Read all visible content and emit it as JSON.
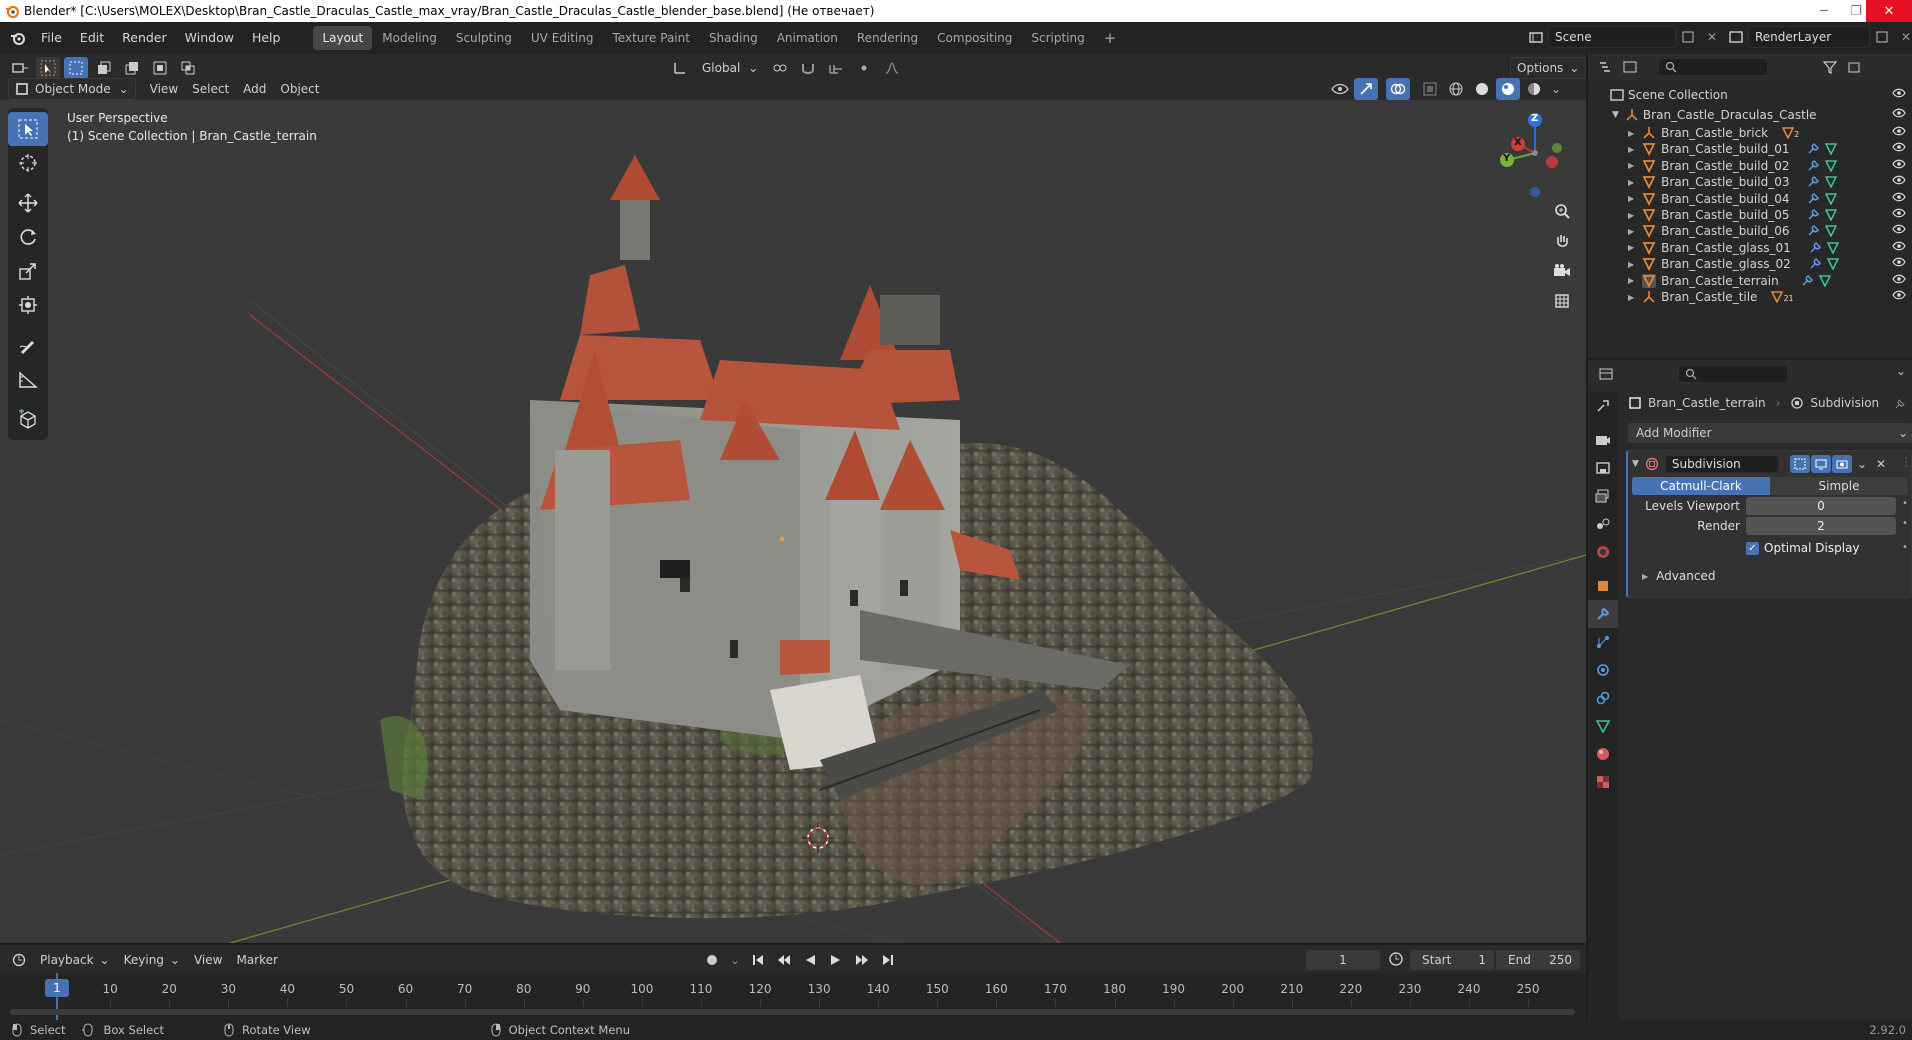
{
  "window": {
    "title": "Blender* [C:\\Users\\MOLEX\\Desktop\\Bran_Castle_Draculas_Castle_max_vray/Bran_Castle_Draculas_Castle_blender_base.blend] (Не отвечает)"
  },
  "menu": [
    "File",
    "Edit",
    "Render",
    "Window",
    "Help"
  ],
  "workspaces": [
    "Layout",
    "Modeling",
    "Sculpting",
    "UV Editing",
    "Texture Paint",
    "Shading",
    "Animation",
    "Rendering",
    "Compositing",
    "Scripting"
  ],
  "active_workspace": "Layout",
  "scene": {
    "name": "Scene",
    "render_layer": "RenderLayer"
  },
  "viewport_header": {
    "transform_orientation": "Global",
    "options_label": "Options",
    "mode": "Object Mode",
    "menus": [
      "View",
      "Select",
      "Add",
      "Object"
    ]
  },
  "viewport": {
    "perspective_label": "User Perspective",
    "collection_label": "(1) Scene Collection | Bran_Castle_terrain",
    "gizmo_axes": {
      "x": "X",
      "y": "Y",
      "z": "Z"
    }
  },
  "outliner": {
    "root": "Scene Collection",
    "collection": "Bran_Castle_Draculas_Castle",
    "items": [
      {
        "name": "Bran_Castle_brick",
        "badge": "2"
      },
      {
        "name": "Bran_Castle_build_01",
        "badge": ""
      },
      {
        "name": "Bran_Castle_build_02",
        "badge": ""
      },
      {
        "name": "Bran_Castle_build_03",
        "badge": ""
      },
      {
        "name": "Bran_Castle_build_04",
        "badge": ""
      },
      {
        "name": "Bran_Castle_build_05",
        "badge": ""
      },
      {
        "name": "Bran_Castle_build_06",
        "badge": ""
      },
      {
        "name": "Bran_Castle_glass_01",
        "badge": ""
      },
      {
        "name": "Bran_Castle_glass_02",
        "badge": ""
      },
      {
        "name": "Bran_Castle_terrain",
        "badge": ""
      },
      {
        "name": "Bran_Castle_tile",
        "badge": "21"
      }
    ]
  },
  "properties": {
    "object_name": "Bran_Castle_terrain",
    "modifier_breadcrumb": "Subdivision",
    "add_modifier_label": "Add Modifier",
    "modifier": {
      "name": "Subdivision",
      "type_options": [
        "Catmull-Clark",
        "Simple"
      ],
      "active_type": "Catmull-Clark",
      "levels_viewport_label": "Levels Viewport",
      "levels_viewport_value": "0",
      "render_label": "Render",
      "render_value": "2",
      "optimal_display_label": "Optimal Display",
      "optimal_display_checked": true,
      "advanced_label": "Advanced"
    }
  },
  "timeline": {
    "menus": [
      "Playback",
      "Keying",
      "View",
      "Marker"
    ],
    "current_frame": "1",
    "start_label": "Start",
    "start_value": "1",
    "end_label": "End",
    "end_value": "250",
    "ticks": [
      "1",
      "10",
      "20",
      "30",
      "40",
      "50",
      "60",
      "70",
      "80",
      "90",
      "100",
      "110",
      "120",
      "130",
      "140",
      "150",
      "160",
      "170",
      "180",
      "190",
      "200",
      "210",
      "220",
      "230",
      "240",
      "250"
    ]
  },
  "statusbar": {
    "select": "Select",
    "box_select": "Box Select",
    "rotate_view": "Rotate View",
    "context_menu": "Object Context Menu",
    "version": "2.92.0"
  },
  "colors": {
    "accent": "#4772b3",
    "object_orange": "#e0883a",
    "mesh_green": "#3fc28b"
  }
}
